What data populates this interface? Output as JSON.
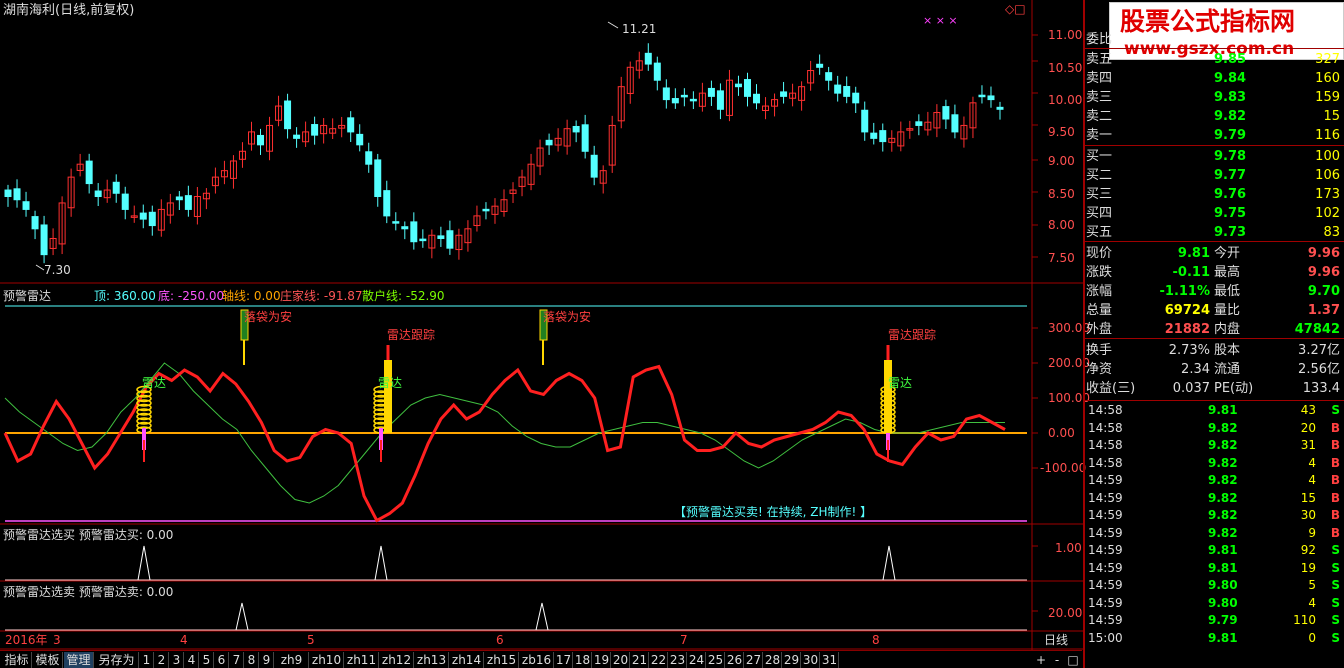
{
  "main_chart": {
    "title": "湖南海利(日线,前复权)",
    "high_label": "11.21",
    "low_label": "7.30",
    "price_ticks": [
      "11.00",
      "10.50",
      "10.00",
      "9.50",
      "9.00",
      "8.50",
      "8.00",
      "7.50"
    ],
    "marks": "×  × ×"
  },
  "radar": {
    "title": "预警雷达",
    "legend": [
      {
        "label": "顶: 360.00",
        "color": "#55ffff"
      },
      {
        "label": "底: -250.00",
        "color": "#ff55ff"
      },
      {
        "label": "轴线: 0.00",
        "color": "#ffa500"
      },
      {
        "label": "庄家线: -91.87",
        "color": "#ff5555"
      },
      {
        "label": "散户线: -52.90",
        "color": "#7cfc00"
      }
    ],
    "ticks": [
      "300.00",
      "200.00",
      "100.00",
      "0.00",
      "-100.00"
    ],
    "labels": {
      "a1": "雷达",
      "a2": "雷达",
      "a3": "雷达",
      "b1": "落袋为安",
      "b2": "落袋为安",
      "c1": "雷达跟踪",
      "c2": "雷达跟踪"
    },
    "notice": "【预警雷达买卖! 在持续, ZH制作! 】"
  },
  "buy_panel": {
    "title": "预警雷达选买  预警雷达买: 0.00",
    "tick": "1.00"
  },
  "sell_panel": {
    "title": "预警雷达选卖  预警雷达卖: 0.00",
    "tick": "20.00"
  },
  "date_axis": {
    "labels": [
      "2016年",
      "3",
      "4",
      "5",
      "6",
      "7",
      "8"
    ],
    "period": "日线"
  },
  "watermark": {
    "line1": "股票公式指标网",
    "line2": "www.gszx.com.cn"
  },
  "order_book": {
    "title": "委比",
    "sells": [
      {
        "label": "卖五",
        "price": "9.85",
        "vol": "327"
      },
      {
        "label": "卖四",
        "price": "9.84",
        "vol": "160"
      },
      {
        "label": "卖三",
        "price": "9.83",
        "vol": "159"
      },
      {
        "label": "卖二",
        "price": "9.82",
        "vol": "15"
      },
      {
        "label": "卖一",
        "price": "9.79",
        "vol": "116"
      }
    ],
    "buys": [
      {
        "label": "买一",
        "price": "9.78",
        "vol": "100"
      },
      {
        "label": "买二",
        "price": "9.77",
        "vol": "106"
      },
      {
        "label": "买三",
        "price": "9.76",
        "vol": "173"
      },
      {
        "label": "买四",
        "price": "9.75",
        "vol": "102"
      },
      {
        "label": "买五",
        "price": "9.73",
        "vol": "83"
      }
    ]
  },
  "quote": [
    {
      "l1": "现价",
      "v1": "9.81",
      "c1": "#00ff00",
      "l2": "今开",
      "v2": "9.96",
      "c2": "#ff5050"
    },
    {
      "l1": "涨跌",
      "v1": "-0.11",
      "c1": "#00ff00",
      "l2": "最高",
      "v2": "9.96",
      "c2": "#ff5050"
    },
    {
      "l1": "涨幅",
      "v1": "-1.11%",
      "c1": "#00ff00",
      "l2": "最低",
      "v2": "9.70",
      "c2": "#00ff00"
    },
    {
      "l1": "总量",
      "v1": "69724",
      "c1": "#ffff00",
      "l2": "量比",
      "v2": "1.37",
      "c2": "#ff5050"
    },
    {
      "l1": "外盘",
      "v1": "21882",
      "c1": "#ff5050",
      "l2": "内盘",
      "v2": "47842",
      "c2": "#00ff00"
    }
  ],
  "stats": [
    {
      "l1": "换手",
      "v1": "2.73%",
      "l2": "股本",
      "v2": "3.27亿"
    },
    {
      "l1": "净资",
      "v1": "2.34",
      "l2": "流通",
      "v2": "2.56亿"
    },
    {
      "l1": "收益(三)",
      "v1": "0.037",
      "l2": "PE(动)",
      "v2": "133.4"
    }
  ],
  "ticks": [
    {
      "t": "14:58",
      "p": "9.81",
      "v": "43",
      "s": "S"
    },
    {
      "t": "14:58",
      "p": "9.82",
      "v": "20",
      "s": "B"
    },
    {
      "t": "14:58",
      "p": "9.82",
      "v": "31",
      "s": "B"
    },
    {
      "t": "14:58",
      "p": "9.82",
      "v": "4",
      "s": "B"
    },
    {
      "t": "14:59",
      "p": "9.82",
      "v": "4",
      "s": "B"
    },
    {
      "t": "14:59",
      "p": "9.82",
      "v": "15",
      "s": "B"
    },
    {
      "t": "14:59",
      "p": "9.82",
      "v": "30",
      "s": "B"
    },
    {
      "t": "14:59",
      "p": "9.82",
      "v": "9",
      "s": "B"
    },
    {
      "t": "14:59",
      "p": "9.81",
      "v": "92",
      "s": "S"
    },
    {
      "t": "14:59",
      "p": "9.81",
      "v": "19",
      "s": "S"
    },
    {
      "t": "14:59",
      "p": "9.80",
      "v": "5",
      "s": "S"
    },
    {
      "t": "14:59",
      "p": "9.80",
      "v": "4",
      "s": "S"
    },
    {
      "t": "14:59",
      "p": "9.79",
      "v": "110",
      "s": "S"
    },
    {
      "t": "15:00",
      "p": "9.81",
      "v": "0",
      "s": "S"
    }
  ],
  "tabs": [
    "指标",
    "模板",
    "管理",
    "另存为",
    "1",
    "2",
    "3",
    "4",
    "5",
    "6",
    "7",
    "8",
    "9",
    "zh9",
    "zh10",
    "zh11",
    "zh12",
    "zh13",
    "zh14",
    "zh15",
    "zb16",
    "17",
    "18",
    "19",
    "20",
    "21",
    "22",
    "23",
    "24",
    "25",
    "26",
    "27",
    "28",
    "29",
    "30",
    "31"
  ],
  "nav": [
    "+",
    "-",
    "□"
  ],
  "colors": {
    "up": "#ff3030",
    "down": "#54ffff",
    "bg": "#000000",
    "frame": "#a00000"
  }
}
